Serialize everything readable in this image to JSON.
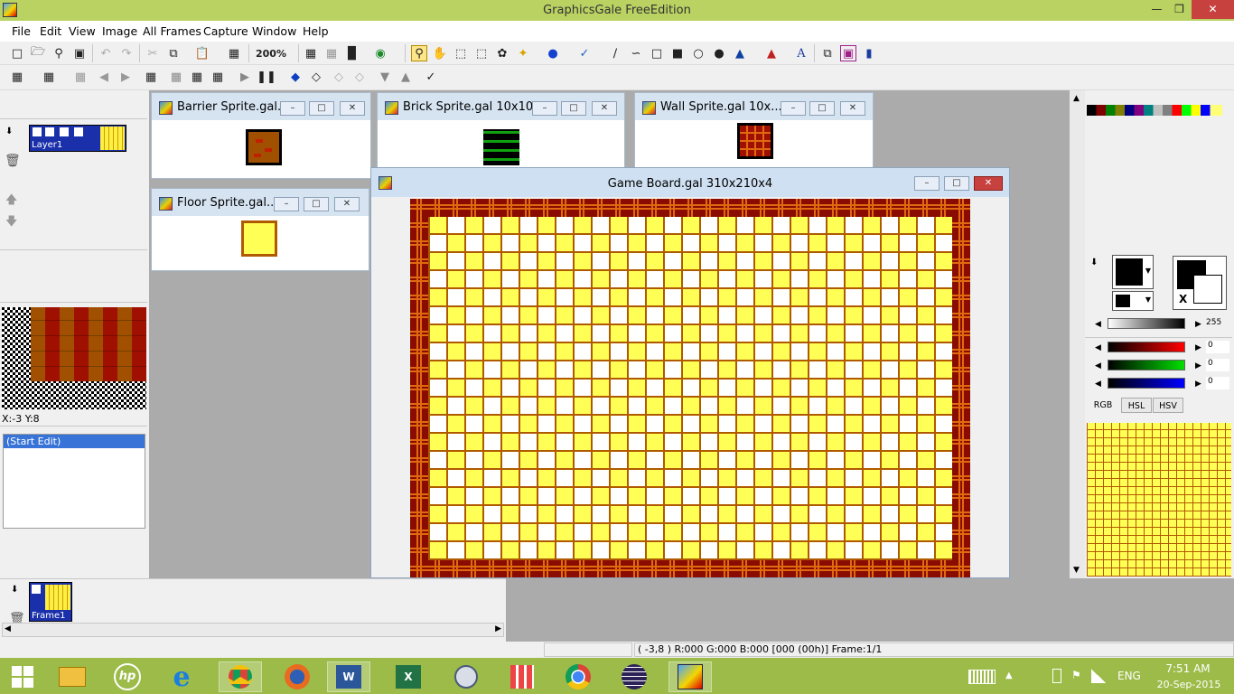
{
  "app": {
    "title": "GraphicsGale FreeEdition"
  },
  "window_controls": {
    "minimize": "—",
    "restore": "❒",
    "close": "✕"
  },
  "menu": [
    "File",
    "Edit",
    "View",
    "Image",
    "All Frames",
    "Capture",
    "Window",
    "Help"
  ],
  "toolbar": {
    "zoom": "200%"
  },
  "layers": {
    "label": "Layer1"
  },
  "coords": "X:-3 Y:8",
  "history": {
    "item": "(Start Edit)"
  },
  "frames": {
    "label": "Frame1"
  },
  "mdi": {
    "barrier": "Barrier Sprite.gal...",
    "brick": "Brick Sprite.gal 10x10...",
    "wall": "Wall Sprite.gal 10x...",
    "floor": "Floor Sprite.gal...",
    "board": "Game Board.gal 310x210x4"
  },
  "color": {
    "gray_val": "255",
    "r_val": "0",
    "g_val": "0",
    "b_val": "0",
    "x_label": "X",
    "tabs": [
      "RGB",
      "HSL",
      "HSV"
    ]
  },
  "status": "( -3,8 ) R:000 G:000 B:000  [000 (00h)]  Frame:1/1",
  "tray": {
    "lang": "ENG",
    "time": "7:51 AM",
    "date": "20-Sep-2015"
  },
  "colors": {
    "accent": "#b9d262",
    "taskbar": "#9cbb48",
    "close": "#c7423e",
    "selection": "#3874d8",
    "board_yellow": "#ffff55",
    "brick_red": "#a01000"
  }
}
